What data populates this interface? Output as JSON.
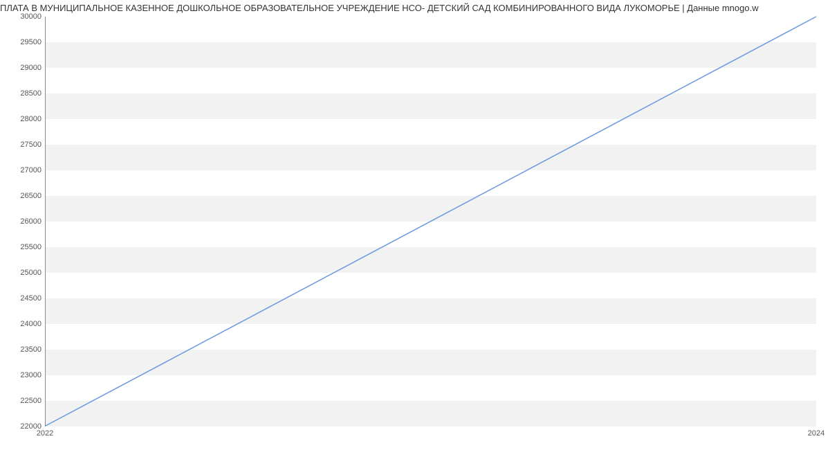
{
  "chart_data": {
    "type": "line",
    "title": "ПЛАТА В МУНИЦИПАЛЬНОЕ КАЗЕННОЕ ДОШКОЛЬНОЕ ОБРАЗОВАТЕЛЬНОЕ УЧРЕЖДЕНИЕ НСО- ДЕТСКИЙ САД КОМБИНИРОВАННОГО ВИДА ЛУКОМОРЬЕ | Данные mnogo.w",
    "x": [
      2022,
      2024
    ],
    "values": [
      22000,
      30000
    ],
    "xlabel": "",
    "ylabel": "",
    "xlim": [
      2022,
      2024
    ],
    "ylim": [
      22000,
      30000
    ],
    "y_ticks": [
      22000,
      22500,
      23000,
      23500,
      24000,
      24500,
      25000,
      25500,
      26000,
      26500,
      27000,
      27500,
      28000,
      28500,
      29000,
      29500,
      30000
    ],
    "x_ticks": [
      2022,
      2024
    ],
    "line_color": "#6a9ae0",
    "grid_band_color": "#f2f2f2"
  }
}
